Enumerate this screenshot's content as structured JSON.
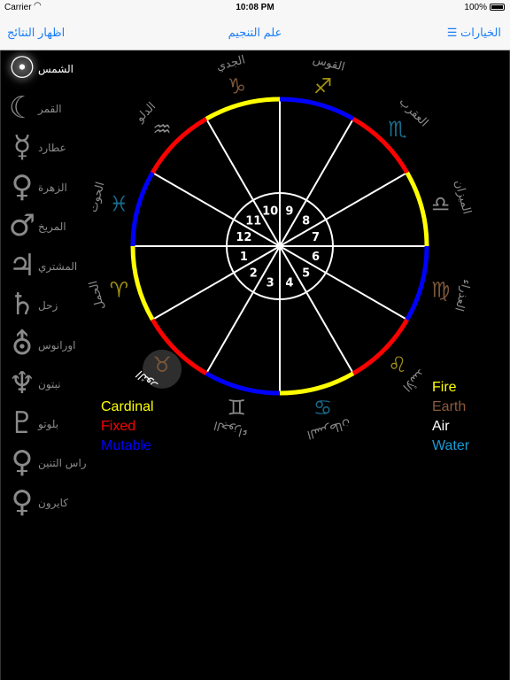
{
  "status_bar": {
    "carrier": "Carrier",
    "time": "10:08 PM",
    "battery": "100%"
  },
  "nav": {
    "show_results": "اظهار النتائج",
    "title": "علم التنجيم",
    "options": "☰ الخيارات"
  },
  "planets": [
    {
      "name": "الشمس",
      "glyph": "☉",
      "icon": "sun-icon",
      "active": true
    },
    {
      "name": "القمر",
      "glyph": "☾",
      "icon": "moon-icon"
    },
    {
      "name": "عطارد",
      "glyph": "☿",
      "icon": "mercury-icon"
    },
    {
      "name": "الزهرة",
      "glyph": "♀",
      "icon": "venus-icon"
    },
    {
      "name": "المريخ",
      "glyph": "♂",
      "icon": "mars-icon"
    },
    {
      "name": "المشتري",
      "glyph": "♃",
      "icon": "jupiter-icon"
    },
    {
      "name": "زحل",
      "glyph": "♄",
      "icon": "saturn-icon"
    },
    {
      "name": "اورانوس",
      "glyph": "⛢",
      "icon": "uranus-icon"
    },
    {
      "name": "نبتون",
      "glyph": "♆",
      "icon": "neptune-icon"
    },
    {
      "name": "بلوتو",
      "glyph": "♇",
      "icon": "pluto-icon"
    },
    {
      "name": "راس التنين",
      "glyph": "♀",
      "icon": "north-node-icon"
    },
    {
      "name": "كايرون",
      "glyph": "♀",
      "icon": "chiron-icon"
    }
  ],
  "houses": [
    "1",
    "2",
    "3",
    "4",
    "5",
    "6",
    "7",
    "8",
    "9",
    "10",
    "11",
    "12"
  ],
  "zodiac": [
    {
      "name": "الحمل",
      "glyph": "♈",
      "icon": "aries-icon",
      "color": "#a09010"
    },
    {
      "name": "الثور",
      "glyph": "♉",
      "icon": "taurus-icon",
      "color": "#7a5538",
      "active": true
    },
    {
      "name": "الجوزاء",
      "glyph": "♊",
      "icon": "gemini-icon",
      "color": "#8a8a8a"
    },
    {
      "name": "السرطان",
      "glyph": "♋",
      "icon": "cancer-icon",
      "color": "#1a6a8a"
    },
    {
      "name": "الأسد",
      "glyph": "♌",
      "icon": "leo-icon",
      "color": "#a09010"
    },
    {
      "name": "العذراء",
      "glyph": "♍",
      "icon": "virgo-icon",
      "color": "#7a5538"
    },
    {
      "name": "الميزان",
      "glyph": "♎",
      "icon": "libra-icon",
      "color": "#8a8a8a"
    },
    {
      "name": "العقرب",
      "glyph": "♏",
      "icon": "scorpio-icon",
      "color": "#1a6a8a"
    },
    {
      "name": "القوس",
      "glyph": "♐",
      "icon": "sagittarius-icon",
      "color": "#a09010"
    },
    {
      "name": "الجدي",
      "glyph": "♑",
      "icon": "capricorn-icon",
      "color": "#7a5538"
    },
    {
      "name": "الدلو",
      "glyph": "♒",
      "icon": "aquarius-icon",
      "color": "#8a8a8a"
    },
    {
      "name": "الحوت",
      "glyph": "♓",
      "icon": "pisces-icon",
      "color": "#1a6a8a"
    }
  ],
  "modality_arc_colors": [
    "#ffff00",
    "#ff0000",
    "#0000ff"
  ],
  "legend_modality": [
    {
      "label": "Cardinal",
      "color": "#ffff00"
    },
    {
      "label": "Fixed",
      "color": "#ff0000"
    },
    {
      "label": "Mutable",
      "color": "#0000ff"
    }
  ],
  "legend_element": [
    {
      "label": "Fire",
      "color": "#ffff00"
    },
    {
      "label": "Earth",
      "color": "#8b5a3c"
    },
    {
      "label": "Air",
      "color": "#ffffff"
    },
    {
      "label": "Water",
      "color": "#1a9ad6"
    }
  ]
}
